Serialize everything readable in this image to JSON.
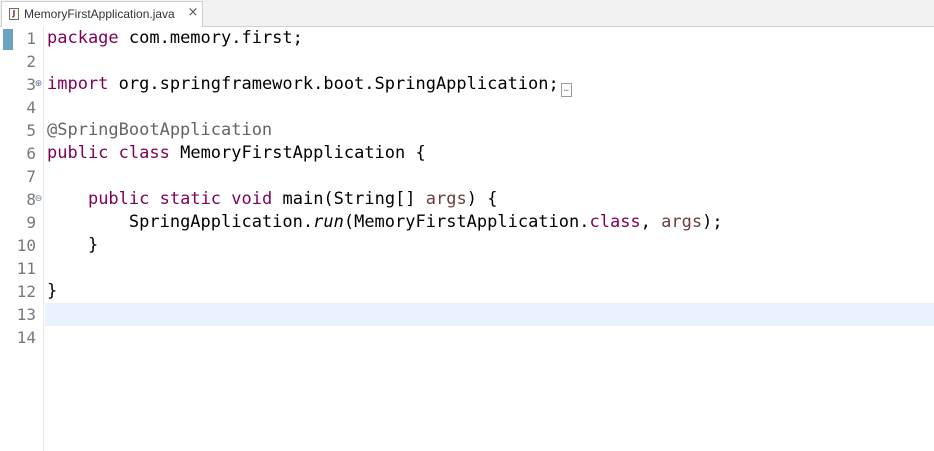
{
  "tab": {
    "filename": "MemoryFirstApplication.java",
    "close_glyph": "×",
    "file_icon_letter": "J"
  },
  "line_numbers": [
    "1",
    "2",
    "3",
    "4",
    "5",
    "6",
    "7",
    "8",
    "9",
    "10",
    "11",
    "12",
    "13",
    "14"
  ],
  "fold_markers": {
    "import": "⊕",
    "method": "⊖"
  },
  "code": {
    "l1_kw": "package",
    "l1_rest": " com.memory.first;",
    "l3_kw": "import",
    "l3_rest": " org.springframework.boot.SpringApplication;",
    "l3_collapsed": "…",
    "l6_annotation": "@SpringBootApplication",
    "l7_kw1": "public",
    "l7_kw2": "class",
    "l7_rest": " MemoryFirstApplication {",
    "l9_indent": "    ",
    "l9_kw1": "public",
    "l9_kw2": "static",
    "l9_kw3": "void",
    "l9_mid": " main(String[] ",
    "l9_param": "args",
    "l9_end": ") {",
    "l10_indent": "        ",
    "l10_pre": "SpringApplication.",
    "l10_method": "run",
    "l10_mid": "(MemoryFirstApplication.",
    "l10_kw": "class",
    "l10_sep": ", ",
    "l10_param": "args",
    "l10_end": ");",
    "l11_text": "    }",
    "l13_text": "}"
  }
}
